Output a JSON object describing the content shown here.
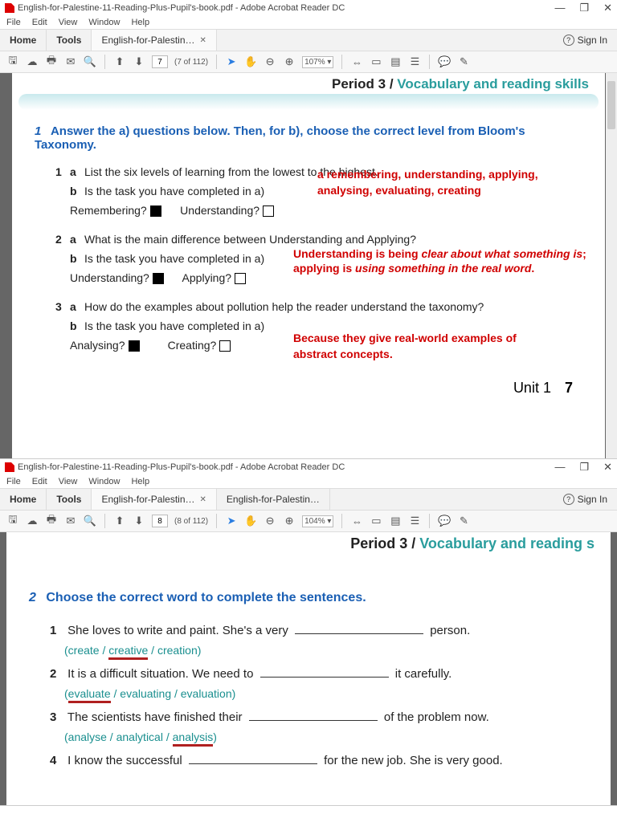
{
  "window1": {
    "title": "English-for-Palestine-11-Reading-Plus-Pupil's-book.pdf - Adobe Acrobat Reader DC",
    "menu": [
      "File",
      "Edit",
      "View",
      "Window",
      "Help"
    ],
    "tabs": {
      "home": "Home",
      "tools": "Tools",
      "doc": "English-for-Palestin…"
    },
    "signin": "Sign In",
    "page_current": "7",
    "page_total": "(7 of 112)",
    "zoom": "107%"
  },
  "page1": {
    "header": {
      "period": "Period 3",
      "slash": " / ",
      "topic": "Vocabulary and reading skills"
    },
    "instr_num": "1",
    "instr": "Answer the a) questions below. Then, for b), choose the correct level from Bloom's Taxonomy.",
    "q1a": "List the six levels of learning from the lowest to the highest.",
    "q1b": "Is the task you have completed in a)",
    "q1_opt1": "Remembering?",
    "q1_opt2": "Understanding?",
    "ans1a": "a remembering, understanding, applying,",
    "ans1b": "analysing, evaluating, creating",
    "q2a": "What is the main difference between Understanding and Applying?",
    "q2b": "Is the task you have completed in a)",
    "q2_opt1": "Understanding?",
    "q2_opt2": "Applying?",
    "ans2a": "Understanding is being ",
    "ans2a_i": "clear about what something is",
    "ans2b": "; applying is ",
    "ans2b_i": "using something in the real word",
    "ans2c": ".",
    "q3a": "How do the examples about pollution help the reader understand the taxonomy?",
    "q3b": "Is the task you have completed in a)",
    "q3_opt1": "Analysing?",
    "q3_opt2": "Creating?",
    "ans3a": "Because they give real-world examples of",
    "ans3b": "abstract concepts.",
    "unit": "Unit 1",
    "pagenum": "7"
  },
  "window2": {
    "title": "English-for-Palestine-11-Reading-Plus-Pupil's-book.pdf - Adobe Acrobat Reader DC",
    "menu": [
      "File",
      "Edit",
      "View",
      "Window",
      "Help"
    ],
    "tabs": {
      "home": "Home",
      "tools": "Tools",
      "doc1": "English-for-Palestin…",
      "doc2": "English-for-Palestin…"
    },
    "signin": "Sign In",
    "page_current": "8",
    "page_total": "(8 of 112)",
    "zoom": "104%"
  },
  "page2": {
    "header": {
      "period": "Period 3",
      "slash": " / ",
      "topic": "Vocabulary and reading s"
    },
    "instr_num": "2",
    "instr": "Choose the correct word to complete the sentences.",
    "s1a": "She loves to write and paint. She's a very",
    "s1b": "person.",
    "s1_opts": {
      "pre": "(create / ",
      "u": "creative",
      "post": " / creation)"
    },
    "s2a": "It is a difficult situation. We need to",
    "s2b": "it carefully.",
    "s2_opts": {
      "pre": "(",
      "u": "evaluate",
      "post": " / evaluating / evaluation)"
    },
    "s3a": "The scientists have finished their",
    "s3b": "of the problem now.",
    "s3_opts": {
      "pre": "(analyse / analytical / ",
      "u": "analysis",
      "post": ")"
    },
    "s4a": "I know the successful",
    "s4b": "for the new job. She is very good."
  }
}
